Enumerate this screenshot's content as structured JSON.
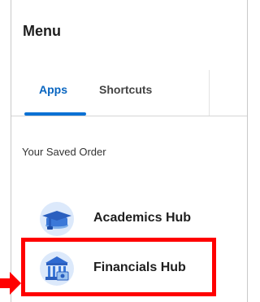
{
  "menu": {
    "title": "Menu",
    "tabs": [
      {
        "label": "Apps",
        "active": true
      },
      {
        "label": "Shortcuts",
        "active": false
      }
    ],
    "section_label": "Your Saved Order",
    "apps": [
      {
        "label": "Academics Hub",
        "icon": "graduation-cap-icon"
      },
      {
        "label": "Financials Hub",
        "icon": "bank-icon"
      }
    ]
  },
  "colors": {
    "accent": "#0b71d4",
    "highlight": "#ff0000",
    "icon_bg": "#dce9fb",
    "icon_fg": "#2f6ad0"
  }
}
